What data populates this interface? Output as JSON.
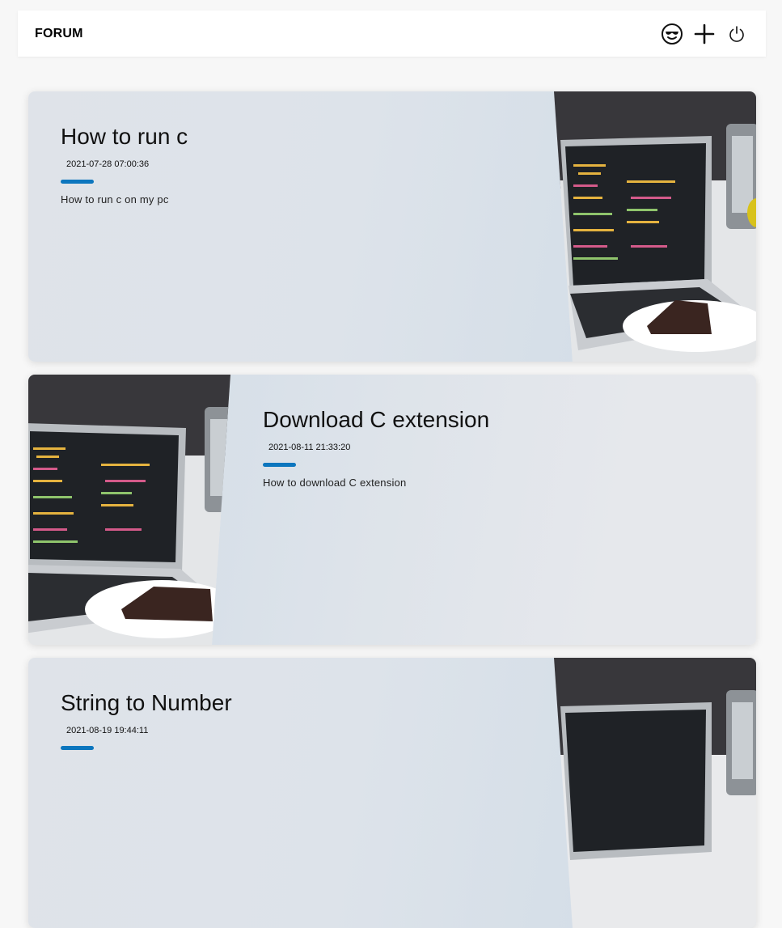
{
  "header": {
    "title": "FORUM",
    "icons": [
      "profile-icon",
      "add-icon",
      "power-icon"
    ]
  },
  "posts": [
    {
      "title": "How to run c",
      "date": "2021-07-28 07:00:36",
      "description": "How to run c on my pc"
    },
    {
      "title": "Download C extension",
      "date": "2021-08-11 21:33:20",
      "description": "How to download C extension"
    },
    {
      "title": "String to Number",
      "date": "2021-08-19 19:44:11",
      "description": ""
    }
  ],
  "colors": {
    "accent": "#0c76be",
    "card_bg": "#dde3ea"
  }
}
